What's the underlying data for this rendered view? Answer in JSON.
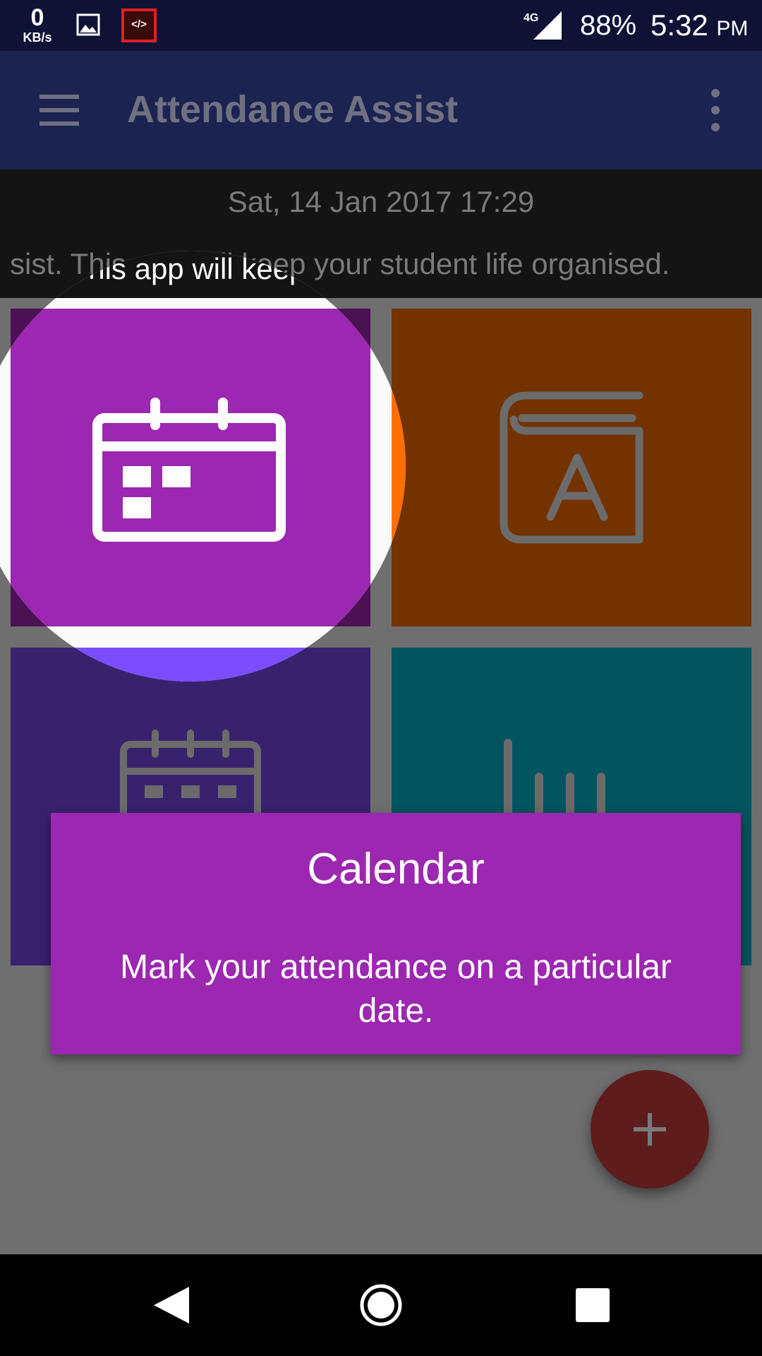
{
  "status_bar": {
    "net_speed_value": "0",
    "net_speed_unit": "KB/s",
    "network_type": "4G",
    "battery": "88%",
    "time": "5:32",
    "ampm": "PM",
    "icons": [
      "gallery-icon",
      "code-icon",
      "signal-icon"
    ]
  },
  "app_bar": {
    "title": "Attendance Assist",
    "icons": [
      "menu-icon",
      "more-vert-icon"
    ]
  },
  "info_band": {
    "datetime": "Sat, 14 Jan 2017 17:29",
    "marquee_text": "sist. This app will keep your student life organised."
  },
  "tiles": [
    {
      "id": "calendar",
      "icon": "calendar-icon",
      "color": "#9c27b0",
      "dim_color": "#4a1252"
    },
    {
      "id": "subjects",
      "icon": "book-icon",
      "color": "#ff6f00",
      "dim_color": "#733200"
    },
    {
      "id": "timetable",
      "icon": "timetable-icon",
      "color": "#7c4dff",
      "dim_color": "#38226e"
    },
    {
      "id": "statistics",
      "icon": "bar-chart-icon",
      "color": "#00bcd4",
      "dim_color": "#02545f"
    }
  ],
  "tooltip": {
    "title": "Calendar",
    "description": "Mark your attendance on a particular date."
  },
  "fab": {
    "icon": "add-icon",
    "color": "#5e1c1c"
  },
  "nav_bar": {
    "icons": [
      "back-icon",
      "home-icon",
      "recents-icon"
    ]
  },
  "colors": {
    "overlay_gray": "#6f6f6f",
    "app_bar": "#1b2350",
    "status_bar": "#0e1336"
  }
}
